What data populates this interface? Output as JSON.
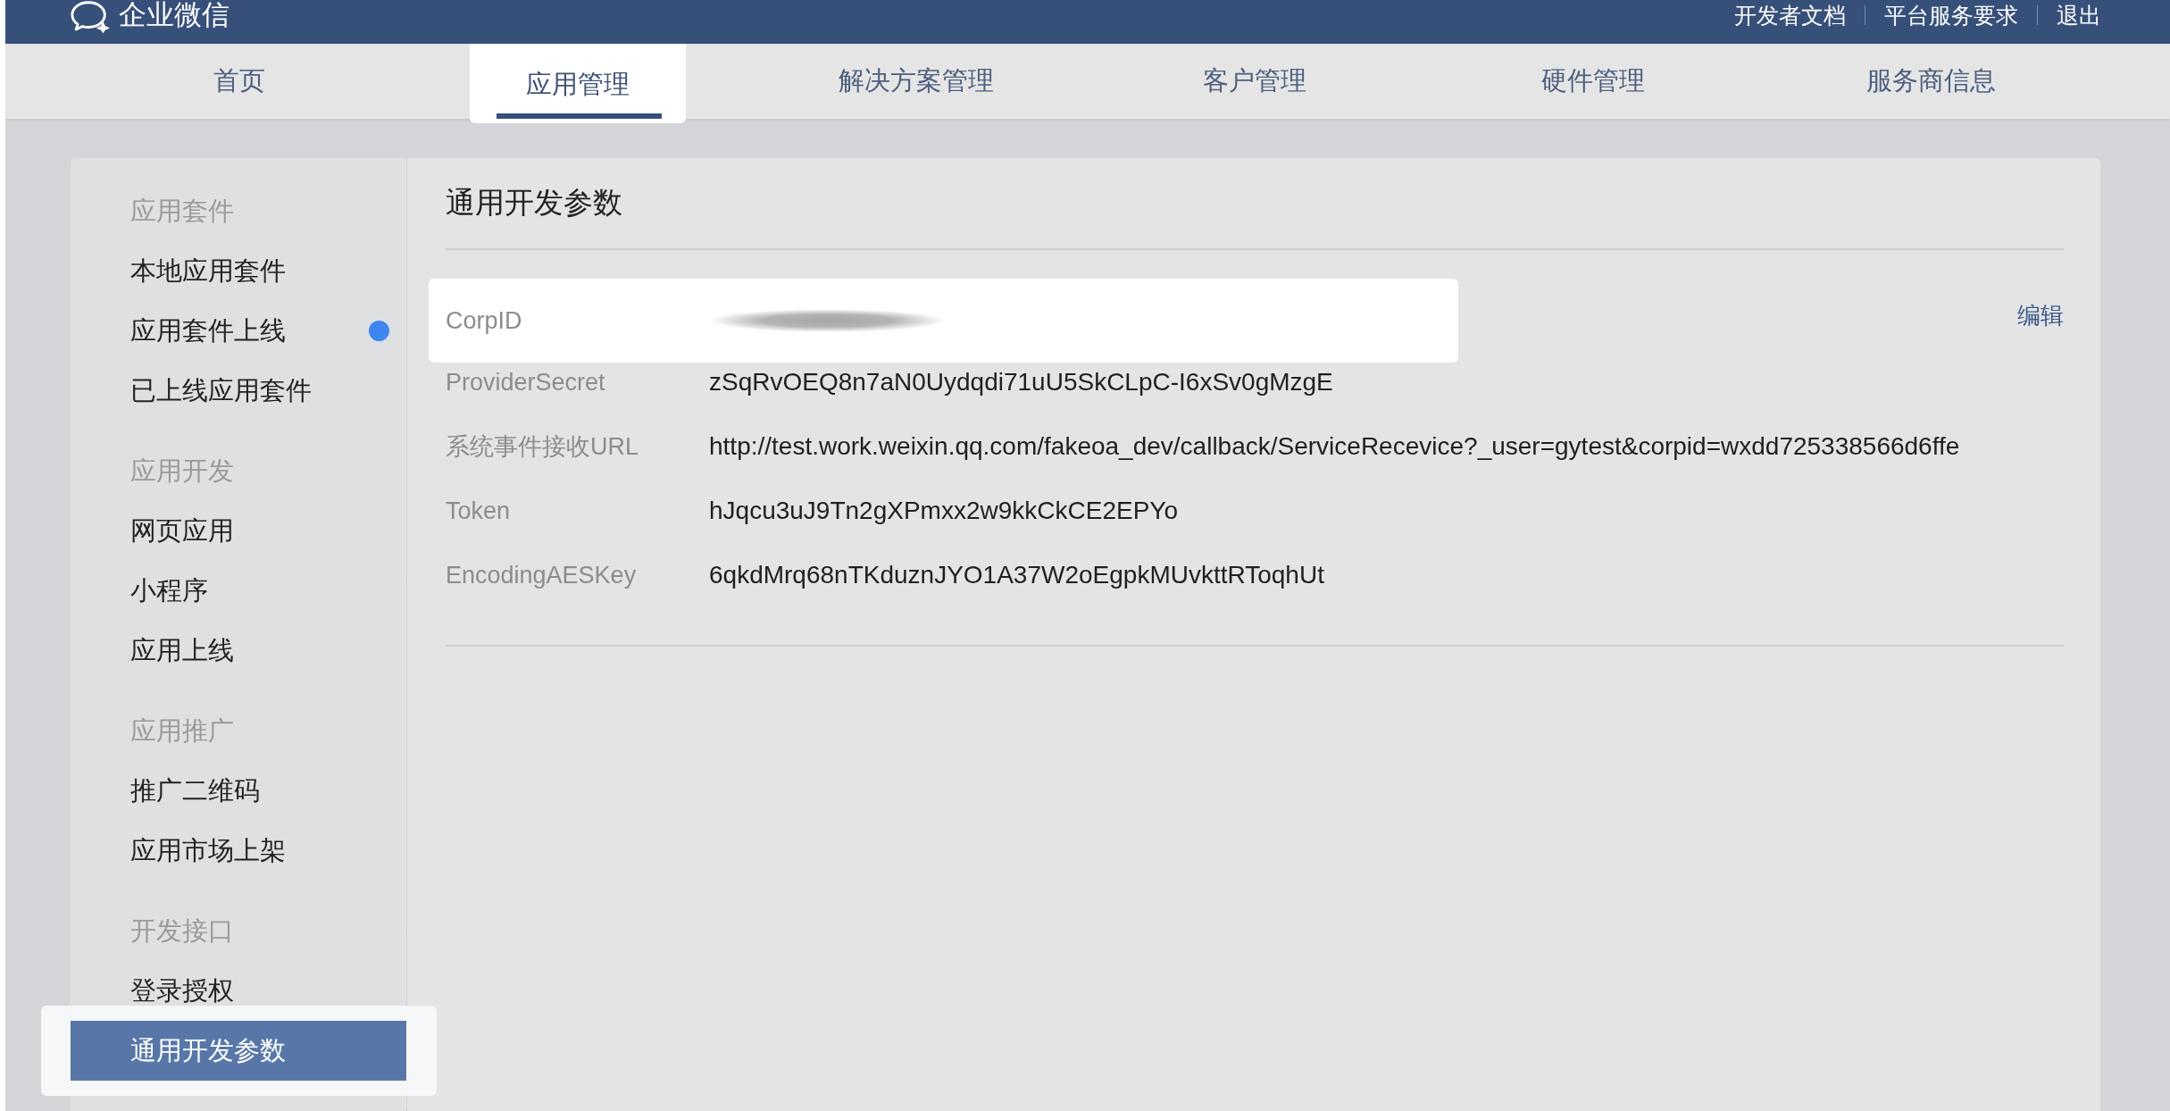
{
  "header": {
    "brand": "企业微信",
    "links": [
      "开发者文档",
      "平台服务要求",
      "退出"
    ]
  },
  "nav_tabs": [
    {
      "label": "首页",
      "selected": false
    },
    {
      "label": "应用管理",
      "selected": true
    },
    {
      "label": "解决方案管理",
      "selected": false
    },
    {
      "label": "客户管理",
      "selected": false
    },
    {
      "label": "硬件管理",
      "selected": false
    },
    {
      "label": "服务商信息",
      "selected": false
    }
  ],
  "sidebar": {
    "groups": [
      {
        "title": "应用套件",
        "items": [
          {
            "label": "本地应用套件",
            "selected": false,
            "dot": false
          },
          {
            "label": "应用套件上线",
            "selected": false,
            "dot": true
          },
          {
            "label": "已上线应用套件",
            "selected": false,
            "dot": false
          }
        ]
      },
      {
        "title": "应用开发",
        "items": [
          {
            "label": "网页应用",
            "selected": false,
            "dot": false
          },
          {
            "label": "小程序",
            "selected": false,
            "dot": false
          },
          {
            "label": "应用上线",
            "selected": false,
            "dot": false
          }
        ]
      },
      {
        "title": "应用推广",
        "items": [
          {
            "label": "推广二维码",
            "selected": false,
            "dot": false
          },
          {
            "label": "应用市场上架",
            "selected": false,
            "dot": false
          }
        ]
      },
      {
        "title": "开发接口",
        "items": [
          {
            "label": "登录授权",
            "selected": false,
            "dot": false
          },
          {
            "label": "通用开发参数",
            "selected": true,
            "dot": false
          }
        ]
      }
    ]
  },
  "panel": {
    "title": "通用开发参数",
    "rows": [
      {
        "label": "CorpID",
        "blurred": true,
        "highlighted": true,
        "action": "编辑"
      },
      {
        "label": "ProviderSecret",
        "value": "zSqRvOEQ8n7aN0Uydqdi71uU5SkCLpC-I6xSv0gMzgE",
        "blurred": false,
        "highlighted": false
      },
      {
        "label": "系统事件接收URL",
        "value": "http://test.work.weixin.qq.com/fakeoa_dev/callback/ServiceRecevice?_user=gytest&corpid=wxdd725338566d6ffe",
        "blurred": false,
        "highlighted": false
      },
      {
        "label": "Token",
        "value": "hJqcu3uJ9Tn2gXPmxx2w9kkCkCE2EPYo",
        "blurred": false,
        "highlighted": false
      },
      {
        "label": "EncodingAESKey",
        "value": "6qkdMrq68nTKduznJYO1A37W2oEgpkMUvkttRToqhUt",
        "blurred": false,
        "highlighted": false
      }
    ]
  }
}
